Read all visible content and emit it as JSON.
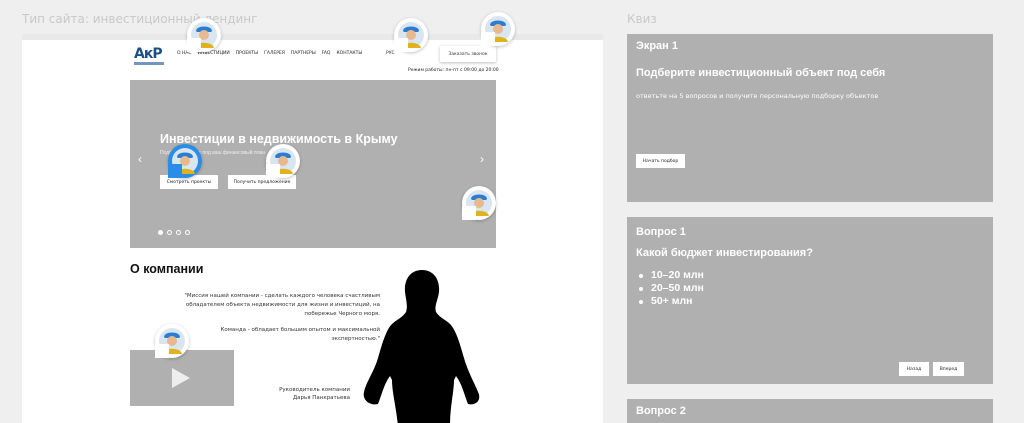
{
  "board": {
    "left_title": "Тип сайта: инвестиционный лендинг",
    "right_title": "Квиз"
  },
  "site": {
    "logo_text": "АкР",
    "nav": [
      "О НАС",
      "ИНВЕСТИЦИИ",
      "ПРОЕКТЫ",
      "ГАЛЕРЕЯ",
      "ПАРТНЕРЫ",
      "FAQ",
      "КОНТАКТЫ"
    ],
    "lang": "РУС",
    "callback_label": "Заказать звонок",
    "hours": "Режим работы: пн-пт с 09:00 до 20:00",
    "hero": {
      "title": "Инвестиции в недвижимость в Крыму",
      "subtitle": "Подберем объект под ваш финансовый план",
      "btn_projects": "Смотреть проекты",
      "btn_offer": "Получить предложение",
      "prev_arrow": "‹",
      "next_arrow": "›"
    },
    "about": {
      "title": "О компании",
      "mission_lines": [
        "\"Миссия нашей компании - сделать каждого человека счастливым",
        "обладателем объекта недвижимости для жизни и инвестиций, на",
        "побережье Черного моря."
      ],
      "team_lines": [
        "Команда - обладает большим опытом и максимальной",
        "экспертностью.\""
      ],
      "director_role": "Руководитель компании",
      "director_name": "Дарья Панкратьева"
    }
  },
  "quiz": {
    "screen1": {
      "label": "Экран 1",
      "heading": "Подберите инвестиционный объект под себя",
      "text": "ответьте на 5 вопросов и получите персональную подборку объектов",
      "start_btn": "Начать подбор"
    },
    "question1": {
      "label": "Вопрос 1",
      "heading": "Какой бюджет инвестирования?",
      "options": [
        "10–20 млн",
        "20–50 млн",
        "50+ млн"
      ],
      "back_btn": "Назад",
      "next_btn": "Вперед"
    },
    "question2": {
      "label": "Вопрос 2"
    }
  },
  "colors": {
    "placeholder_gray": "#b0b0b0",
    "canvas": "#efefef",
    "logo_blue": "#1c4f8a",
    "avatar_active_blue": "#2a8de6"
  }
}
